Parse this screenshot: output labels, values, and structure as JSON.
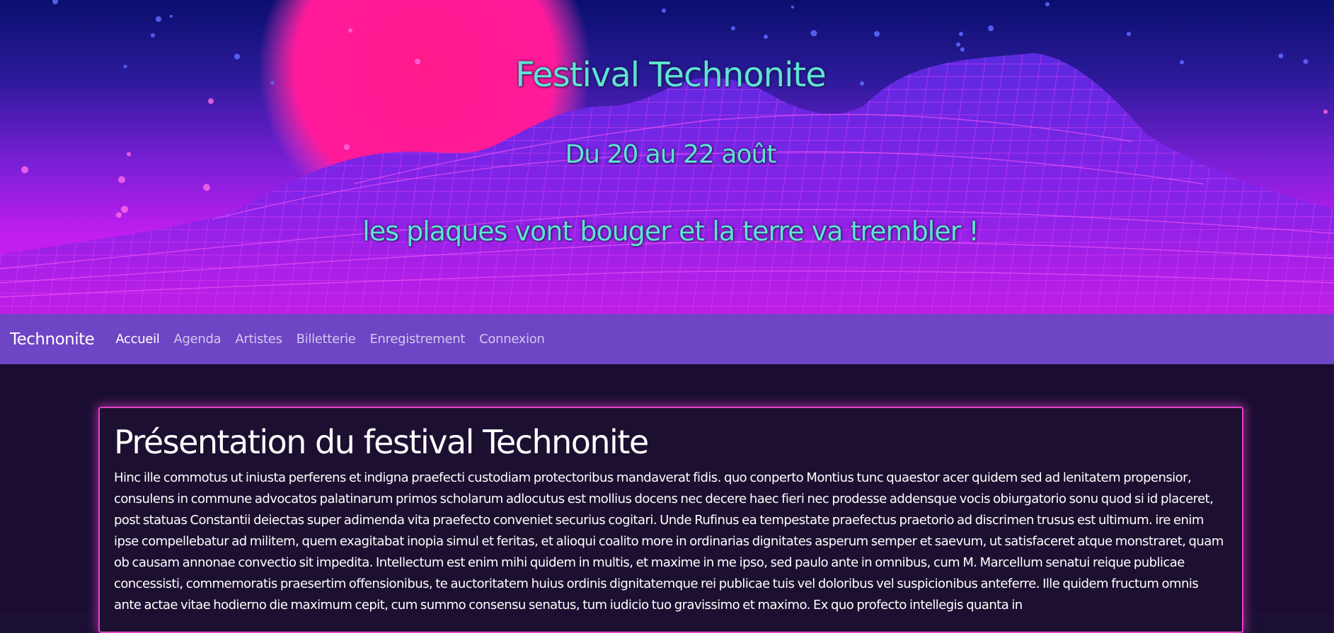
{
  "hero": {
    "title": "Festival Technonite",
    "dates": "Du 20 au 22 août",
    "tagline": "les plaques vont bouger et la terre va trembler !"
  },
  "navbar": {
    "brand": "Technonite",
    "links": [
      "Accueil",
      "Agenda",
      "Artistes",
      "Billetterie",
      "Enregistrement",
      "Connexion"
    ],
    "active": "Accueil",
    "color": "#6e45c4"
  },
  "presentation": {
    "heading": "Présentation du festival Technonite",
    "body": "Hinc ille commotus ut iniusta perferens et indigna praefecti custodiam protectoribus mandaverat fidis. quo conperto Montius tunc quaestor acer quidem sed ad lenitatem propensior, consulens in commune advocatos palatinarum primos scholarum adlocutus est mollius docens nec decere haec fieri nec prodesse addensque vocis obiurgatorio sonu quod si id placeret, post statuas Constantii deiectas super adimenda vita praefecto conveniet securius cogitari. Unde Rufinus ea tempestate praefectus praetorio ad discrimen trusus est ultimum. ire enim ipse compellebatur ad militem, quem exagitabat inopia simul et feritas, et alioqui coalito more in ordinarias dignitates asperum semper et saevum, ut satisfaceret atque monstraret, quam ob causam annonae convectio sit impedita. Intellectum est enim mihi quidem in multis, et maxime in me ipso, sed paulo ante in omnibus, cum M. Marcellum senatui reique publicae concessisti, commemoratis praesertim offensionibus, te auctoritatem huius ordinis dignitatemque rei publicae tuis vel doloribus vel suspicionibus anteferre. Ille quidem fructum omnis ante actae vitae hodierno die maximum cepit, cum summo consensu senatus, tum iudicio tuo gravissimo et maximo. Ex quo profecto intellegis quanta in"
  },
  "colors": {
    "accent_text": "#5ee3d4",
    "card_border": "#e043c4",
    "page_bg": "#1a0d31"
  }
}
